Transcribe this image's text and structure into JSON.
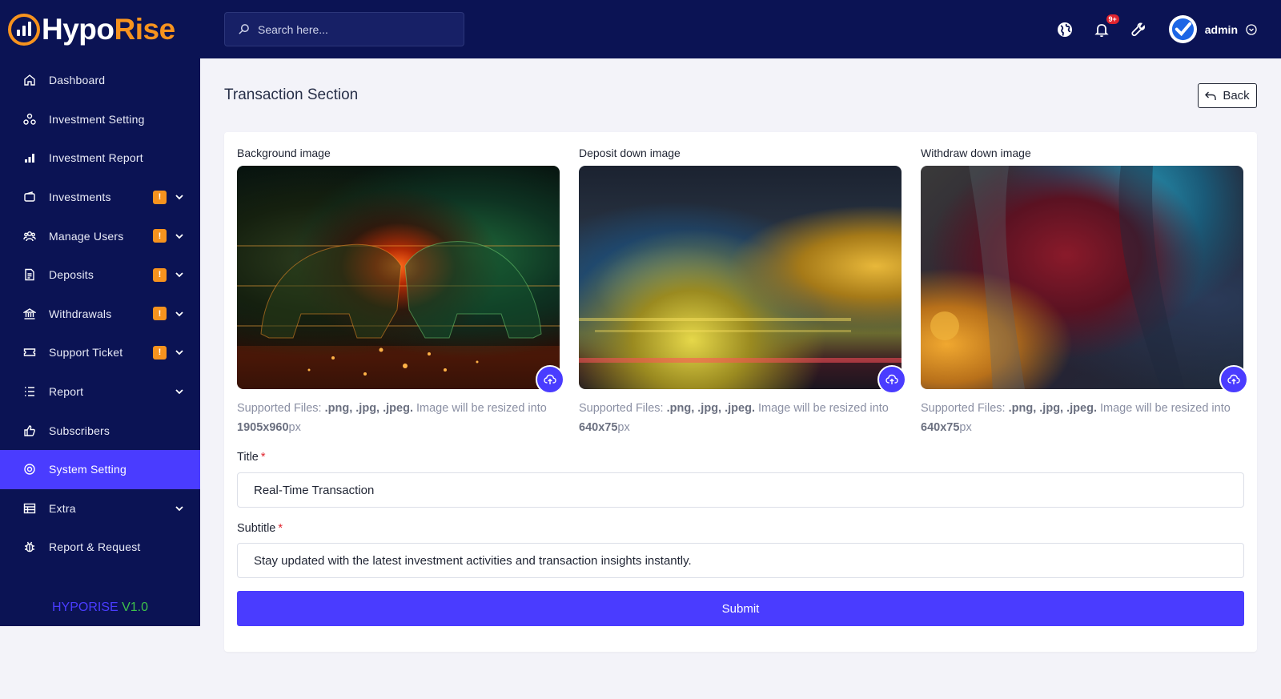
{
  "brand": {
    "name_part1": "Hypo",
    "name_part2": "Rise",
    "version_name": "HYPORISE",
    "version_number": "V1.0",
    "accent": "#4a3cff",
    "orange": "#f7931e",
    "navy": "#0b1354"
  },
  "search": {
    "placeholder": "Search here..."
  },
  "header": {
    "notification_count": "9+",
    "user_name": "admin"
  },
  "sidebar": {
    "items": [
      {
        "label": "Dashboard",
        "icon": "home-icon",
        "badge": "",
        "has_children": false
      },
      {
        "label": "Investment Setting",
        "icon": "nodes-icon",
        "badge": "",
        "has_children": false
      },
      {
        "label": "Investment Report",
        "icon": "bar-chart-icon",
        "badge": "",
        "has_children": false
      },
      {
        "label": "Investments",
        "icon": "wallet-icon",
        "badge": "!",
        "has_children": true
      },
      {
        "label": "Manage Users",
        "icon": "users-icon",
        "badge": "!",
        "has_children": true
      },
      {
        "label": "Deposits",
        "icon": "receipt-icon",
        "badge": "!",
        "has_children": true
      },
      {
        "label": "Withdrawals",
        "icon": "bank-icon",
        "badge": "!",
        "has_children": true
      },
      {
        "label": "Support Ticket",
        "icon": "ticket-icon",
        "badge": "!",
        "has_children": true
      },
      {
        "label": "Report",
        "icon": "list-icon",
        "badge": "",
        "has_children": true
      },
      {
        "label": "Subscribers",
        "icon": "thumbs-up-icon",
        "badge": "",
        "has_children": false
      },
      {
        "label": "System Setting",
        "icon": "settings-icon",
        "badge": "",
        "has_children": false,
        "active": true
      },
      {
        "label": "Extra",
        "icon": "table-icon",
        "badge": "",
        "has_children": true
      },
      {
        "label": "Report & Request",
        "icon": "bug-icon",
        "badge": "",
        "has_children": false
      }
    ]
  },
  "page": {
    "title": "Transaction Section",
    "back_label": "Back"
  },
  "images": [
    {
      "label": "Background image",
      "hint_prefix": "Supported Files:",
      "formats": ".png, .jpg, .jpeg.",
      "hint_middle": "Image will be resized into",
      "size": "1905x960",
      "unit": "px"
    },
    {
      "label": "Deposit down image",
      "hint_prefix": "Supported Files:",
      "formats": ".png, .jpg, .jpeg.",
      "hint_middle": "Image will be resized into",
      "size": "640x75",
      "unit": "px"
    },
    {
      "label": "Withdraw down image",
      "hint_prefix": "Supported Files:",
      "formats": ".png, .jpg, .jpeg.",
      "hint_middle": "Image will be resized into",
      "size": "640x75",
      "unit": "px"
    }
  ],
  "form": {
    "title_label": "Title",
    "title_value": "Real-Time Transaction",
    "subtitle_label": "Subtitle",
    "subtitle_value": "Stay updated with the latest investment activities and transaction insights instantly.",
    "required_mark": "*",
    "submit_label": "Submit"
  }
}
